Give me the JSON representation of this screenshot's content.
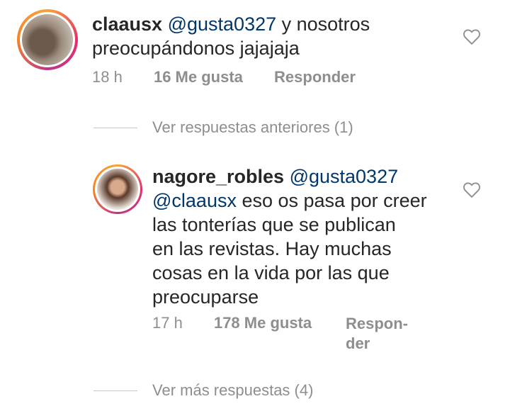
{
  "comment1": {
    "username": "claausx",
    "mention": "@gusta0327",
    "text": " y nosotros",
    "text_line2": "preocupándonos jajajaja",
    "time": "18 h",
    "likes": "16 Me gusta",
    "reply": "Responder"
  },
  "view_previous": "Ver respuestas anteriores (1)",
  "comment2": {
    "username": "nagore_robles",
    "mention1": "@gusta0327",
    "mention2": "@claausx",
    "text_line2": " eso os pasa por creer",
    "text_line3": "las tonterías que se publican",
    "text_line4": "en las revistas. Hay muchas",
    "text_line5": "cosas en la vida por las que",
    "text_line6": "preocuparse",
    "time": "17 h",
    "likes": "178 Me gusta",
    "reply_line1": "Respon-",
    "reply_line2": "der"
  },
  "view_more": "Ver más respuestas (4)",
  "colors": {
    "mention": "#00376b",
    "muted": "#8e8e8e",
    "text": "#262626"
  },
  "icons": [
    "heart-icon"
  ]
}
